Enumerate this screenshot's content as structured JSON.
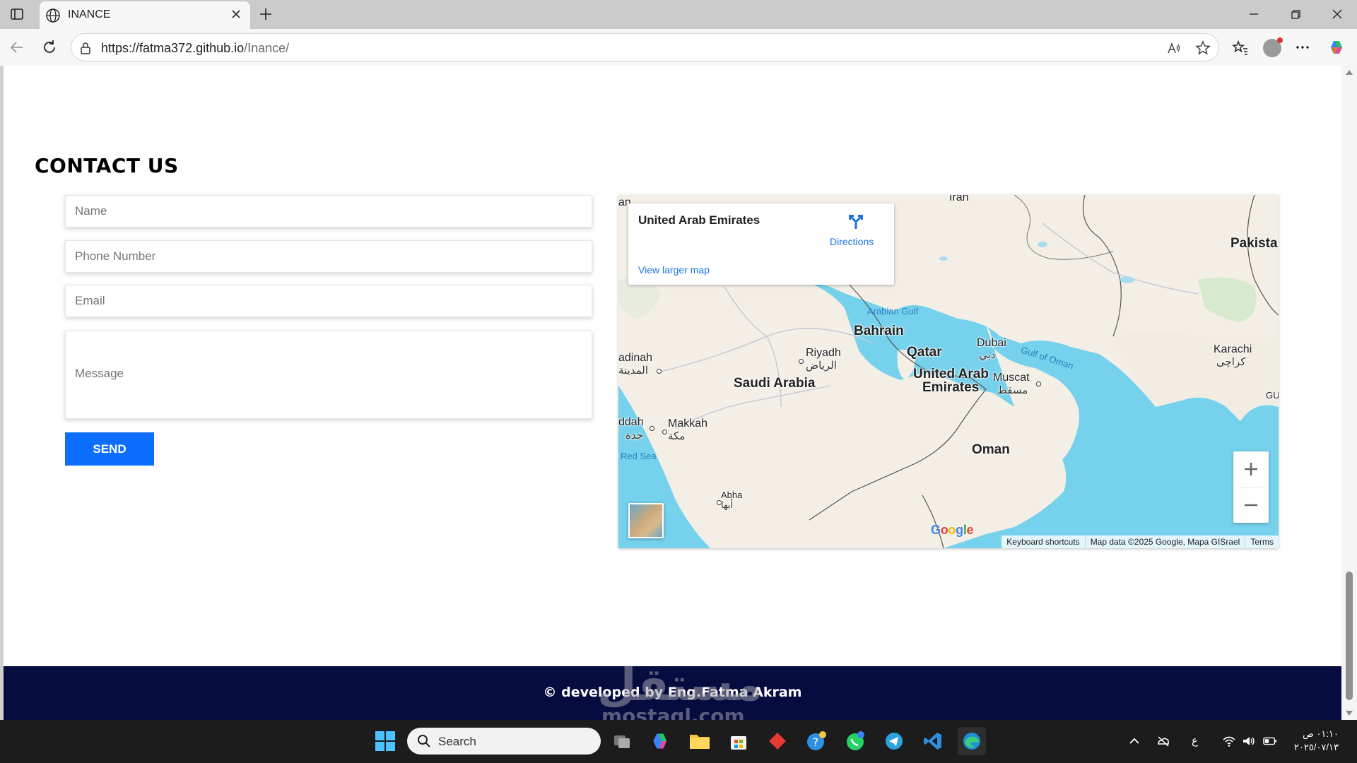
{
  "browser": {
    "tab_title": "INANCE",
    "url_host": "https://fatma372.github.io",
    "url_path": "/Inance/"
  },
  "contact": {
    "title": "CONTACT US",
    "name_placeholder": "Name",
    "phone_placeholder": "Phone Number",
    "email_placeholder": "Email",
    "message_placeholder": "Message",
    "send_label": "SEND"
  },
  "map": {
    "place_name": "United Arab Emirates",
    "directions_label": "Directions",
    "view_larger_label": "View larger map",
    "labels": {
      "iran": "Iran",
      "pakistan": "Pakista",
      "arabian_gulf": "Arabian Gulf",
      "bahrain": "Bahrain",
      "qatar": "Qatar",
      "dubai": "Dubai",
      "dubai_ar": "دبي",
      "gulf_of_oman": "Gulf of Oman",
      "karachi": "Karachi",
      "karachi_ar": "کراچی",
      "madinah": "adinah",
      "madinah_ar": "المدينة",
      "riyadh": "Riyadh",
      "riyadh_ar": "الرياض",
      "uae_line1": "United Arab",
      "uae_line2": "Emirates",
      "muscat": "Muscat",
      "muscat_ar": "مسقط",
      "saudi": "Saudi Arabia",
      "jeddah": "ddah",
      "jeddah_ar": "جدة",
      "makkah": "Makkah",
      "makkah_ar": "مكة",
      "red_sea": "Red Sea",
      "oman": "Oman",
      "abha": "Abha",
      "abha_ar": "أبها",
      "gu": "GU",
      "an": "an"
    },
    "google": "Google",
    "keyboard_shortcuts": "Keyboard shortcuts",
    "map_data": "Map data ©2025 Google, Mapa GISrael",
    "terms": "Terms",
    "zoom_in": "+",
    "zoom_out": "−"
  },
  "footer": {
    "text": "© developed by Eng.Fatma Akram"
  },
  "watermark": {
    "arabic": "مستقل",
    "latin": "mostaql.com"
  },
  "taskbar": {
    "search_placeholder": "Search",
    "language": "ع",
    "time": "٠١:١٠ ص",
    "date": "٢٠٢٥/٠٧/١٣"
  },
  "colors": {
    "accent": "#0d6efd",
    "footer_bg": "#060b40",
    "map_water": "#75d1ec"
  }
}
